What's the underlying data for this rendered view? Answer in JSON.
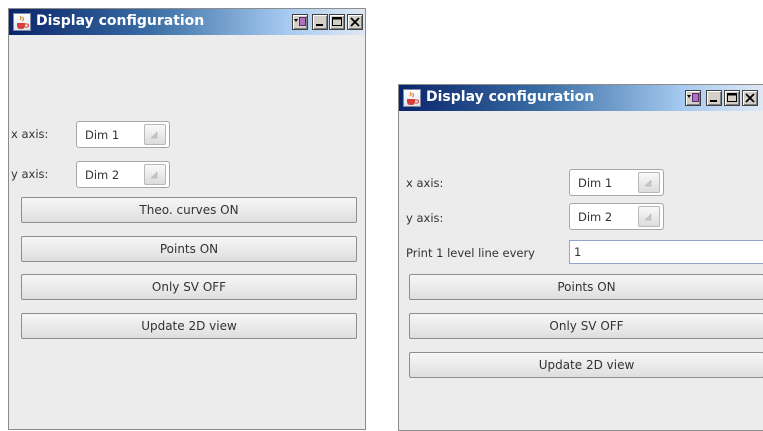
{
  "window1": {
    "title": "Display configuration",
    "x_axis_label": "x axis:",
    "x_axis_value": "Dim 1",
    "y_axis_label": "y axis:",
    "y_axis_value": "Dim 2",
    "theo_curves_label": "Theo. curves ON",
    "points_label": "Points ON",
    "only_sv_label": "Only SV OFF",
    "update_label": "Update 2D view"
  },
  "window2": {
    "title": "Display configuration",
    "x_axis_label": "x axis:",
    "x_axis_value": "Dim 1",
    "y_axis_label": "y axis:",
    "y_axis_value": "Dim 2",
    "level_line_label": "Print 1 level line every",
    "level_line_value": "1",
    "points_label": "Points ON",
    "only_sv_label": "Only SV OFF",
    "update_label": "Update 2D view"
  },
  "icons": {
    "app": "java-cup-icon",
    "menu": "window-menu-icon",
    "minimize": "minimize-icon",
    "maximize": "maximize-icon",
    "close": "close-icon",
    "dropdown": "dropdown-arrow-icon"
  },
  "colors": {
    "titlebar_dark": "#0a246a",
    "titlebar_light": "#a6caf0",
    "panel_bg": "#ececec",
    "button_border": "#8e8e8e"
  }
}
